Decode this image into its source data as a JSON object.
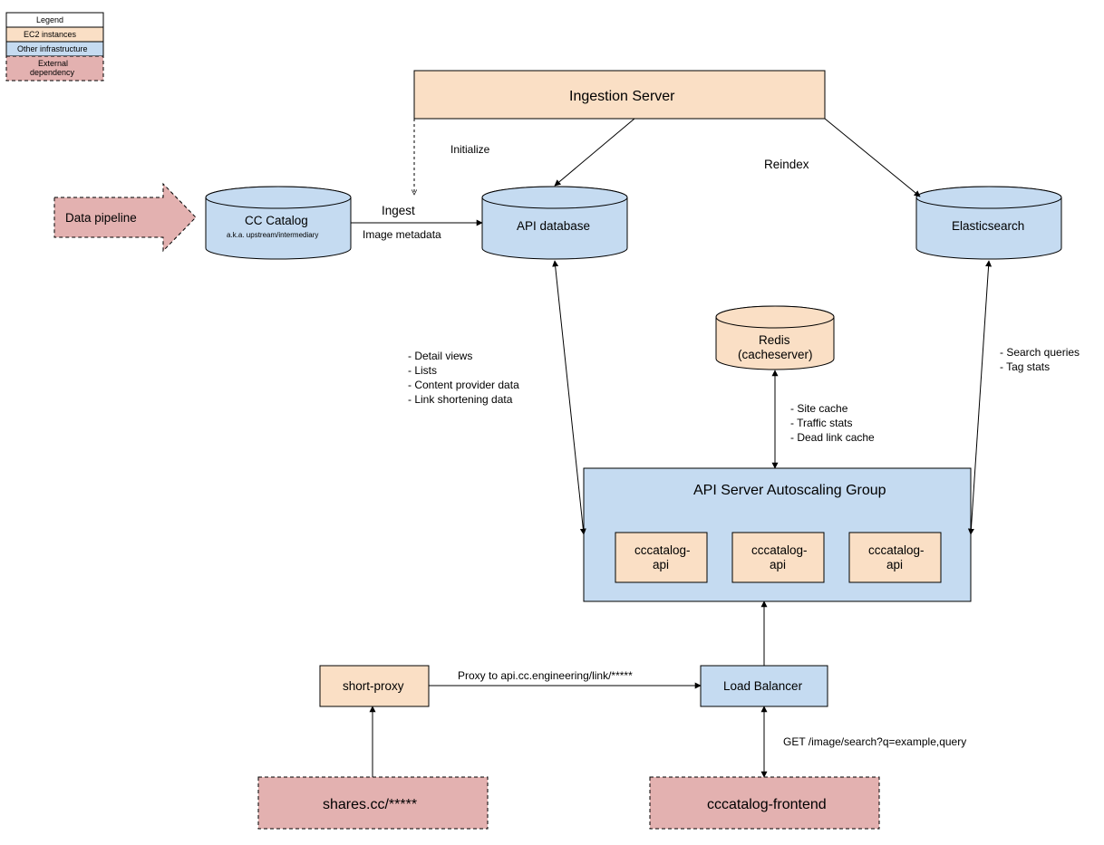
{
  "legend": {
    "title": "Legend",
    "rows": [
      "EC2 instances",
      "Other infrastructure",
      "External dependency"
    ]
  },
  "nodes": {
    "ingestion": {
      "label": "Ingestion Server"
    },
    "pipeline": {
      "label": "Data pipeline"
    },
    "catalog": {
      "label": "CC Catalog",
      "sub": "a.k.a. upstream/intermediary"
    },
    "apidb": {
      "label": "API database"
    },
    "elastic": {
      "label": "Elasticsearch"
    },
    "redis": {
      "label": "Redis",
      "sub": "(cacheserver)"
    },
    "asg": {
      "label": "API Server Autoscaling Group"
    },
    "api1": {
      "label1": "cccatalog-",
      "label2": "api"
    },
    "api2": {
      "label1": "cccatalog-",
      "label2": "api"
    },
    "api3": {
      "label1": "cccatalog-",
      "label2": "api"
    },
    "shortproxy": {
      "label": "short-proxy"
    },
    "lb": {
      "label": "Load Balancer"
    },
    "shares": {
      "label": "shares.cc/*****"
    },
    "frontend": {
      "label": "cccatalog-frontend"
    }
  },
  "edges": {
    "initialize": "Initialize",
    "ingest": "Ingest",
    "ingest_sub": "Image metadata",
    "reindex": "Reindex",
    "proxy": "Proxy to api.cc.engineering/link/*****",
    "get": "GET /image/search?q=example,query"
  },
  "notes": {
    "apidb_list": [
      "- Detail views",
      "- Lists",
      "- Content provider data",
      "- Link shortening data"
    ],
    "redis_list": [
      "- Site cache",
      "- Traffic stats",
      "- Dead link cache"
    ],
    "elastic_list": [
      "- Search queries",
      "- Tag stats"
    ]
  }
}
